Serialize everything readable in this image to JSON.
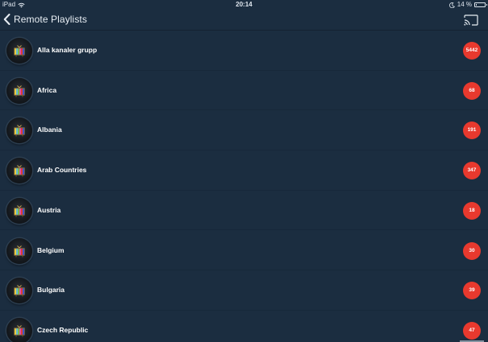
{
  "status_bar": {
    "device": "iPad",
    "time": "20:14",
    "battery_percent": "14 %",
    "battery_level_fraction": 0.14
  },
  "nav": {
    "title": "Remote Playlists",
    "back_icon": "chevron-left-icon",
    "cast_icon": "cast-icon"
  },
  "colors": {
    "background": "#1b2d40",
    "badge": "#e8392e",
    "text": "#ffffff"
  },
  "playlists": [
    {
      "label": "Alla kanaler grupp",
      "count": "5442",
      "icon": "tv-icon"
    },
    {
      "label": "Africa",
      "count": "68",
      "icon": "tv-icon"
    },
    {
      "label": "Albania",
      "count": "191",
      "icon": "tv-icon"
    },
    {
      "label": "Arab Countries",
      "count": "347",
      "icon": "tv-icon"
    },
    {
      "label": "Austria",
      "count": "18",
      "icon": "tv-icon"
    },
    {
      "label": "Belgium",
      "count": "30",
      "icon": "tv-icon"
    },
    {
      "label": "Bulgaria",
      "count": "39",
      "icon": "tv-icon"
    },
    {
      "label": "Czech Republic",
      "count": "47",
      "icon": "tv-icon"
    }
  ]
}
